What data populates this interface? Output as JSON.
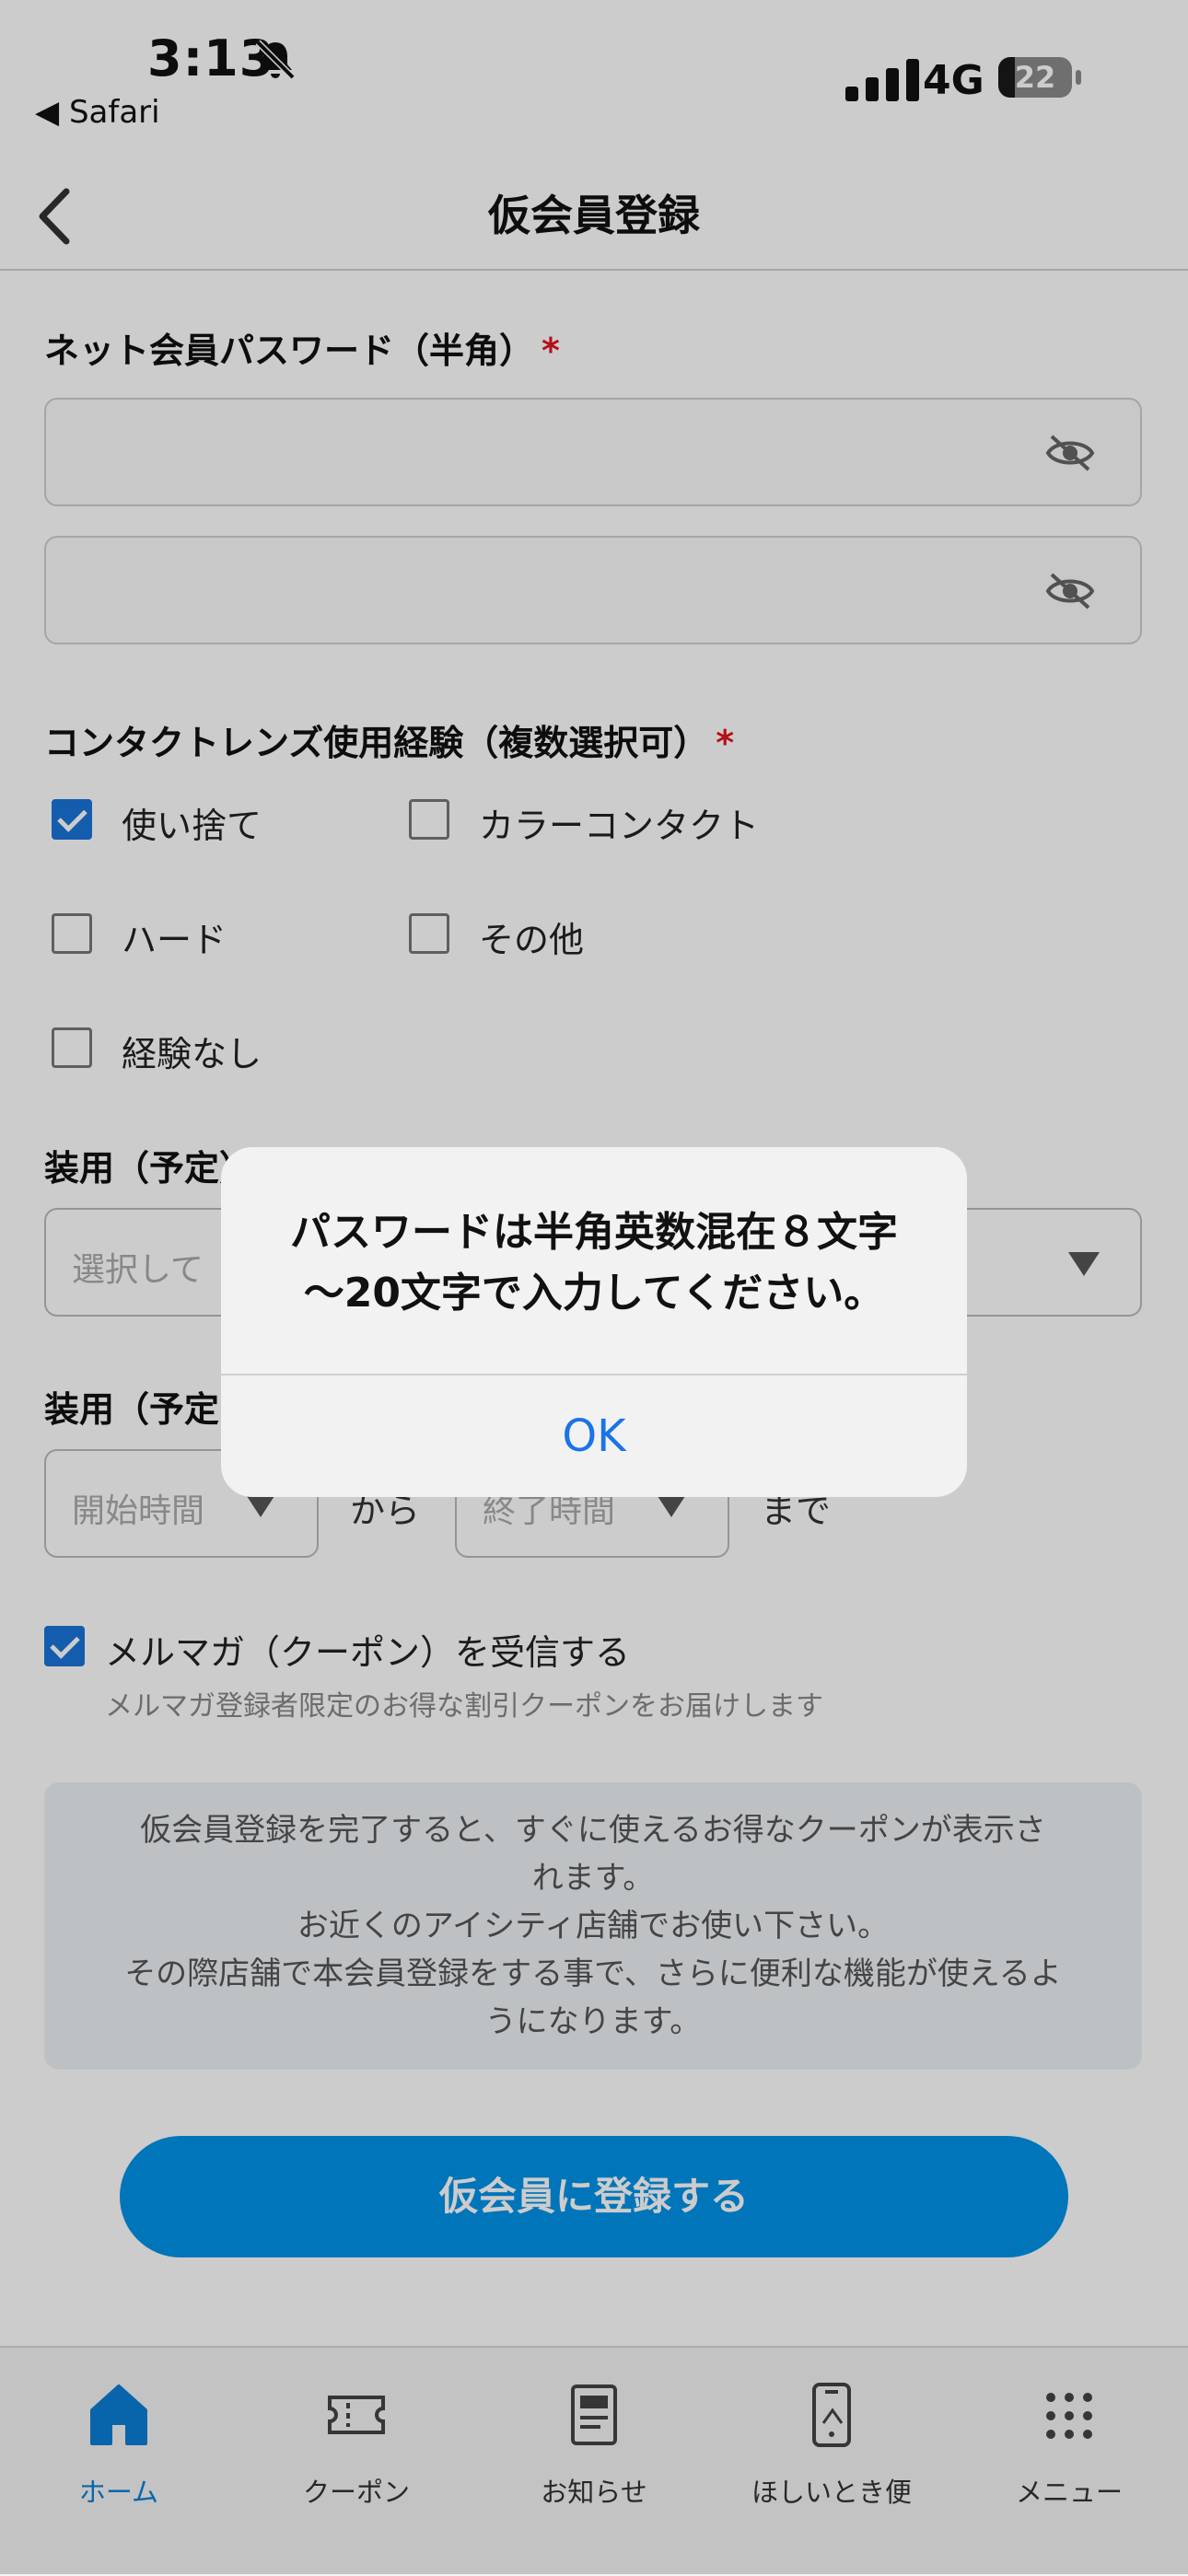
{
  "status_bar": {
    "time": "3:13",
    "back_app": "◀ Safari",
    "network": "4G",
    "battery": "22",
    "battery_level": 0.22
  },
  "nav": {
    "title": "仮会員登録"
  },
  "password": {
    "label": "ネット会員パスワード（半角）",
    "required_mark": "*"
  },
  "contact": {
    "label": "コンタクトレンズ使用経験（複数選択可）",
    "required_mark": "*",
    "options": [
      {
        "label": "使い捨て",
        "checked": true
      },
      {
        "label": "カラーコンタクト",
        "checked": false
      },
      {
        "label": "ハード",
        "checked": false
      },
      {
        "label": "その他",
        "checked": false
      },
      {
        "label": "経験なし",
        "checked": false
      }
    ]
  },
  "wearing_days": {
    "label": "装用（予定）曜",
    "placeholder": "選択して"
  },
  "wearing_time": {
    "label": "装用（予定",
    "start_placeholder": "開始時間",
    "from": "から",
    "end_placeholder": "終了時間",
    "until": "まで"
  },
  "newsletter": {
    "label": "メルマガ（クーポン）を受信する",
    "checked": true,
    "description": "メルマガ登録者限定のお得な割引クーポンをお届けします"
  },
  "info": {
    "lines": [
      "仮会員登録を完了すると、すぐに使えるお得なクーポンが表示さ",
      "れます。",
      "お近くのアイシティ店舗でお使い下さい。",
      "その際店舗で本会員登録をする事で、さらに便利な機能が使えるよ",
      "うになります。"
    ]
  },
  "submit": {
    "label": "仮会員に登録する"
  },
  "tabs": [
    {
      "label": "ホーム",
      "icon": "home-icon",
      "active": true
    },
    {
      "label": "クーポン",
      "icon": "ticket-icon",
      "active": false
    },
    {
      "label": "お知らせ",
      "icon": "news-icon",
      "active": false
    },
    {
      "label": "ほしいとき便",
      "icon": "phone-icon",
      "active": false
    },
    {
      "label": "メニュー",
      "icon": "grid-icon",
      "active": false
    }
  ],
  "alert": {
    "line1": "パスワードは半角英数混在８文字",
    "line2": "～20文字で入力してください。",
    "ok": "OK"
  },
  "colors": {
    "accent": "#1a73d9",
    "button": "#0093e8",
    "required": "#e0141e",
    "tab_active": "#0a7fd6"
  }
}
